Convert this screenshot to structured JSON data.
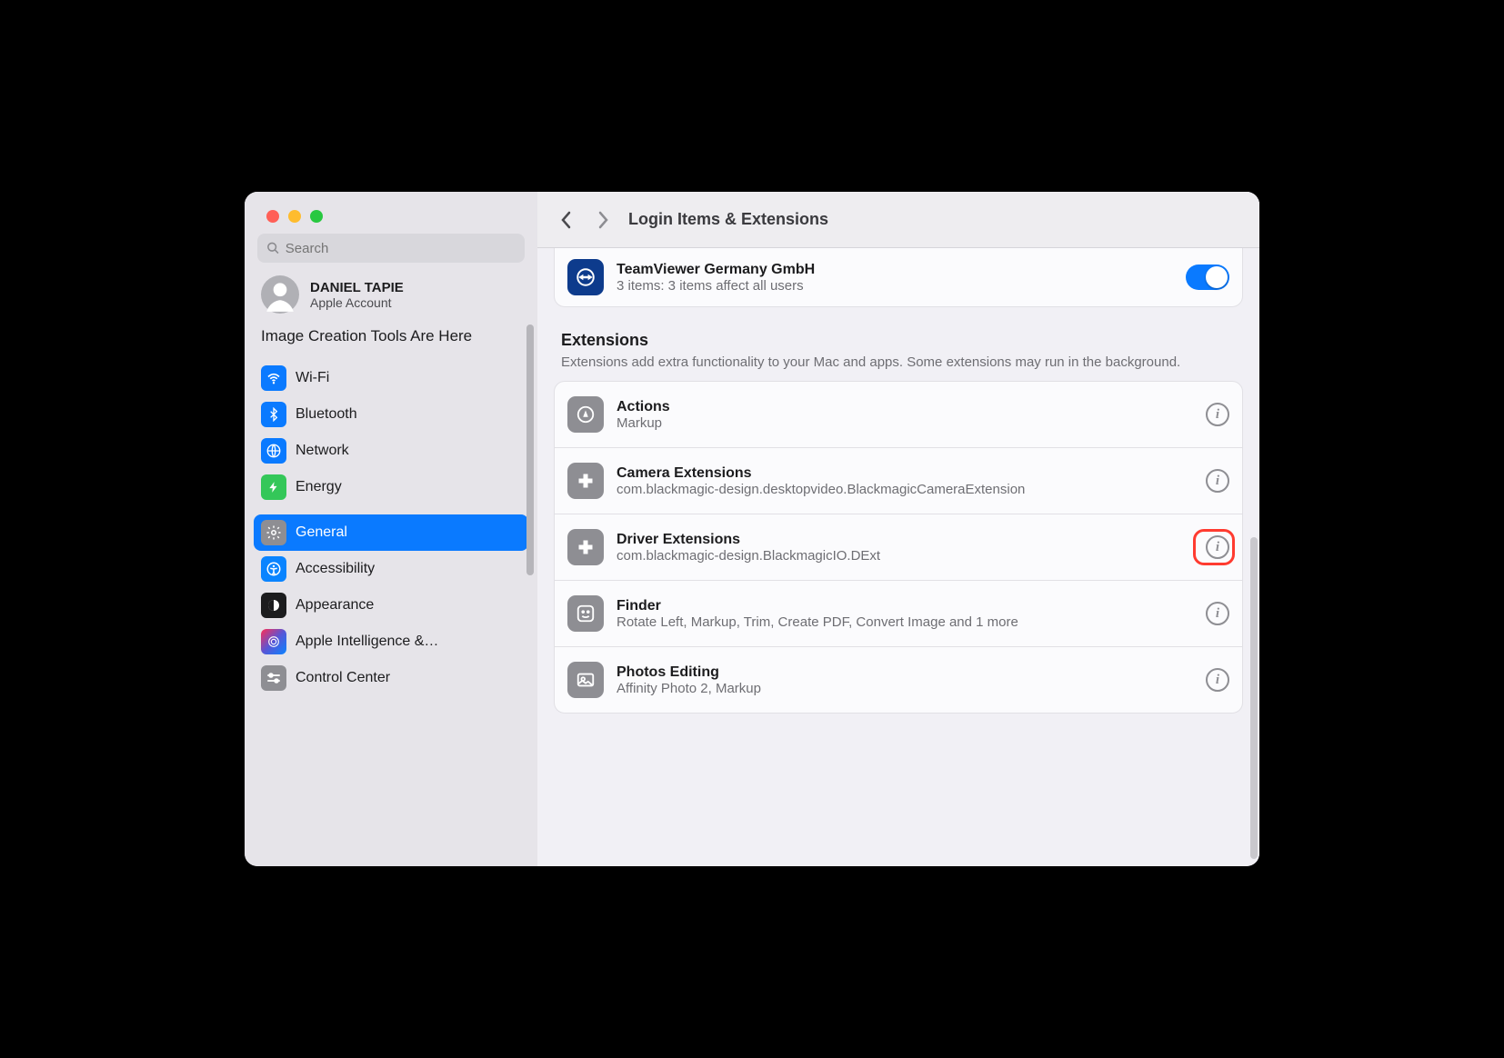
{
  "window": {
    "search_placeholder": "Search",
    "account": {
      "name": "DANIEL TAPIE",
      "sub": "Apple Account"
    },
    "promo": "Image Creation Tools Are Here"
  },
  "sidebar": {
    "items": [
      {
        "label": "Wi-Fi"
      },
      {
        "label": "Bluetooth"
      },
      {
        "label": "Network"
      },
      {
        "label": "Energy"
      },
      {
        "label": "General"
      },
      {
        "label": "Accessibility"
      },
      {
        "label": "Appearance"
      },
      {
        "label": "Apple Intelligence &…"
      },
      {
        "label": "Control Center"
      }
    ]
  },
  "header": {
    "title": "Login Items & Extensions"
  },
  "login_items": {
    "row": {
      "title": "TeamViewer Germany GmbH",
      "sub": "3 items: 3 items affect all users",
      "on": true
    }
  },
  "extensions_section": {
    "title": "Extensions",
    "desc": "Extensions add extra functionality to your Mac and apps. Some extensions may run in the background."
  },
  "extensions": [
    {
      "title": "Actions",
      "sub": "Markup"
    },
    {
      "title": "Camera Extensions",
      "sub": "com.blackmagic-design.desktopvideo.BlackmagicCameraExtension"
    },
    {
      "title": "Driver Extensions",
      "sub": "com.blackmagic-design.BlackmagicIO.DExt"
    },
    {
      "title": "Finder",
      "sub": "Rotate Left, Markup, Trim, Create PDF, Convert Image and 1 more"
    },
    {
      "title": "Photos Editing",
      "sub": "Affinity Photo 2, Markup"
    }
  ]
}
